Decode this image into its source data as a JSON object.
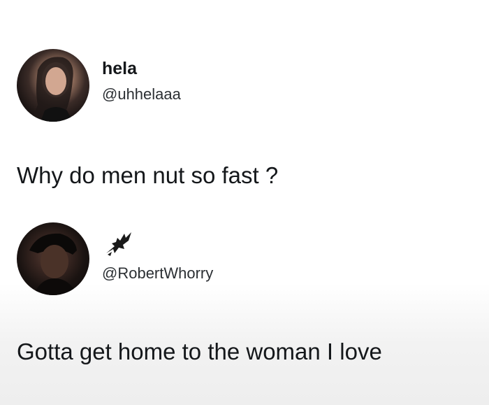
{
  "tweets": [
    {
      "display_name": "hela",
      "handle": "@uhhelaaa",
      "text": "Why do men nut so fast ?"
    },
    {
      "display_name": "",
      "handle": "@RobertWhorry",
      "text": "Gotta get home to the woman I love"
    }
  ]
}
